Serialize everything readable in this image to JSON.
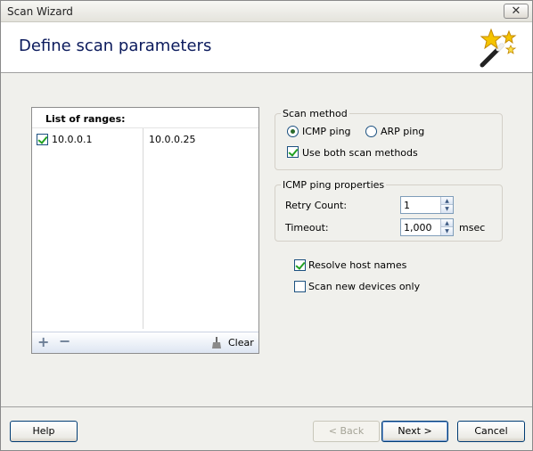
{
  "window": {
    "title": "Scan Wizard",
    "close_glyph": "✕"
  },
  "header": {
    "title": "Define scan parameters",
    "icon": "magic-wand-icon"
  },
  "ranges": {
    "header": "List of ranges:",
    "items": [
      {
        "checked": true,
        "from": "10.0.0.1",
        "to": "10.0.0.25"
      }
    ],
    "toolbar": {
      "add_glyph": "+",
      "remove_glyph": "−",
      "clear_label": "Clear"
    }
  },
  "scan_method": {
    "label": "Scan method",
    "options": [
      {
        "label": "ICMP ping",
        "selected": true
      },
      {
        "label": "ARP ping",
        "selected": false
      }
    ],
    "use_both": {
      "label": "Use both scan methods",
      "checked": true
    }
  },
  "icmp": {
    "label": "ICMP ping properties",
    "retry_label": "Retry Count:",
    "retry_value": "1",
    "timeout_label": "Timeout:",
    "timeout_value": "1,000",
    "timeout_unit": "msec"
  },
  "options": {
    "resolve": {
      "label": "Resolve host names",
      "checked": true
    },
    "new_only": {
      "label": "Scan new devices only",
      "checked": false
    }
  },
  "buttons": {
    "help": "Help",
    "back": "< Back",
    "next": "Next >",
    "cancel": "Cancel"
  }
}
